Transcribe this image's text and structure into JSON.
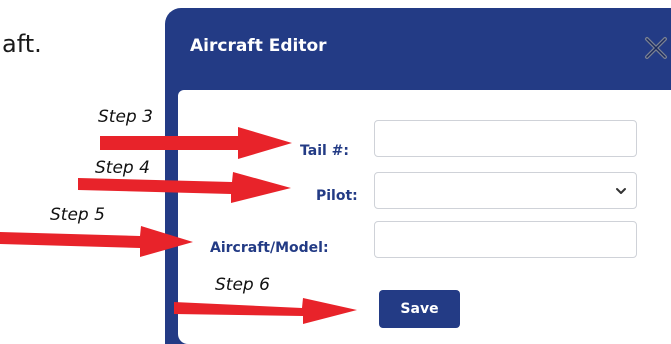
{
  "background_text": "aft.",
  "dialog": {
    "title": "Aircraft Editor",
    "close_label": "X"
  },
  "form": {
    "tail": {
      "label": "Tail #:",
      "value": ""
    },
    "pilot": {
      "label": "Pilot:",
      "selected": ""
    },
    "model": {
      "label": "Aircraft/Model:",
      "value": ""
    },
    "save_label": "Save"
  },
  "annotations": {
    "step3": "Step 3",
    "step4": "Step 4",
    "step5": "Step 5",
    "step6": "Step 6"
  },
  "colors": {
    "dialog": "#233b85",
    "arrow": "#e8232a"
  }
}
